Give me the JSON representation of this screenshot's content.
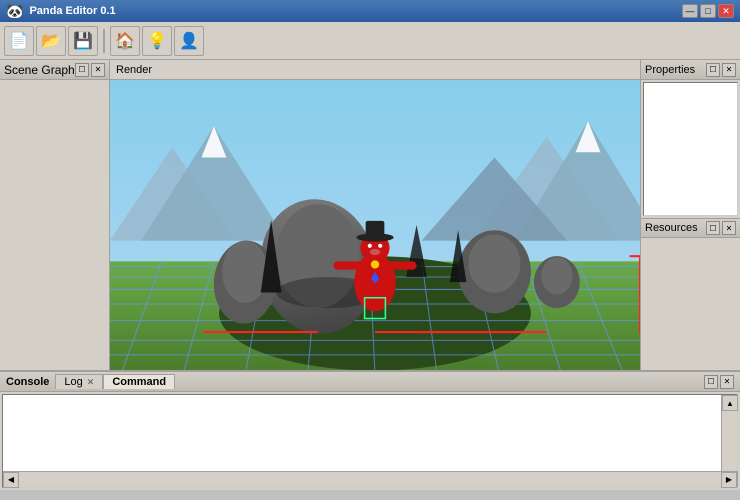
{
  "window": {
    "title": "Panda Editor 0.1",
    "controls": {
      "minimize": "—",
      "maximize": "□",
      "close": "✕"
    }
  },
  "toolbar": {
    "buttons": [
      {
        "name": "new-button",
        "icon": "📄",
        "label": "New"
      },
      {
        "name": "open-button",
        "icon": "📂",
        "label": "Open"
      },
      {
        "name": "save-button",
        "icon": "💾",
        "label": "Save"
      },
      {
        "name": "home-button",
        "icon": "🏠",
        "label": "Home"
      },
      {
        "name": "light-button",
        "icon": "💡",
        "label": "Light"
      },
      {
        "name": "character-button",
        "icon": "👤",
        "label": "Character"
      }
    ]
  },
  "panels": {
    "scene_graph": {
      "title": "Scene Graph",
      "controls": [
        "restore",
        "close"
      ]
    },
    "render": {
      "title": "Render"
    },
    "properties": {
      "title": "Properties"
    },
    "resources": {
      "title": "Resources"
    }
  },
  "console": {
    "title": "Console",
    "tabs": [
      {
        "label": "Log",
        "closeable": true,
        "active": false
      },
      {
        "label": "Command",
        "closeable": false,
        "active": true
      }
    ],
    "controls": {
      "restore": "☐",
      "close": "✕"
    }
  },
  "scene": {
    "background_sky": "#87CEEB",
    "grid_color": "rgba(100,150,255,0.6)",
    "floor_color": "#5a8a3a"
  }
}
